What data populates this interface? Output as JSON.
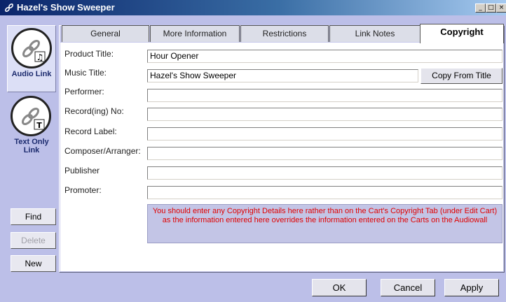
{
  "window": {
    "title": "Hazel's Show Sweeper",
    "controls": {
      "minimize": "_",
      "maximize": "□",
      "close": "×"
    }
  },
  "left_panel": {
    "links": [
      {
        "label": "Audio Link",
        "icon": "audio-link-icon",
        "selected": true
      },
      {
        "label": "Text Only Link",
        "icon": "text-link-icon",
        "selected": false
      }
    ],
    "buttons": {
      "find": "Find",
      "delete": "Delete",
      "new": "New"
    }
  },
  "tabs": [
    {
      "label": "General",
      "active": false
    },
    {
      "label": "More Information",
      "active": false
    },
    {
      "label": "Restrictions",
      "active": false
    },
    {
      "label": "Link Notes",
      "active": false
    },
    {
      "label": "Copyright",
      "active": true
    }
  ],
  "form": {
    "product_title": {
      "label": "Product Title:",
      "value": "Hour Opener"
    },
    "music_title": {
      "label": "Music Title:",
      "value": "Hazel's Show Sweeper"
    },
    "copy_from_title": "Copy From Title",
    "performer": {
      "label": "Performer:",
      "value": ""
    },
    "record_no": {
      "label": "Record(ing) No:",
      "value": ""
    },
    "record_label": {
      "label": "Record Label:",
      "value": ""
    },
    "composer": {
      "label": "Composer/Arranger:",
      "value": ""
    },
    "publisher": {
      "label": "Publisher",
      "value": ""
    },
    "promoter": {
      "label": "Promoter:",
      "value": ""
    },
    "note": "You should enter any Copyright Details here rather than on the Cart's Copyright Tab (under Edit Cart) as the information entered here overrides the information entered on the Carts on the Audiowall"
  },
  "footer": {
    "ok": "OK",
    "cancel": "Cancel",
    "apply": "Apply"
  },
  "colors": {
    "title_bar": "#0a246a",
    "window_bg": "#bcbfe8",
    "note_text": "#e00000"
  }
}
